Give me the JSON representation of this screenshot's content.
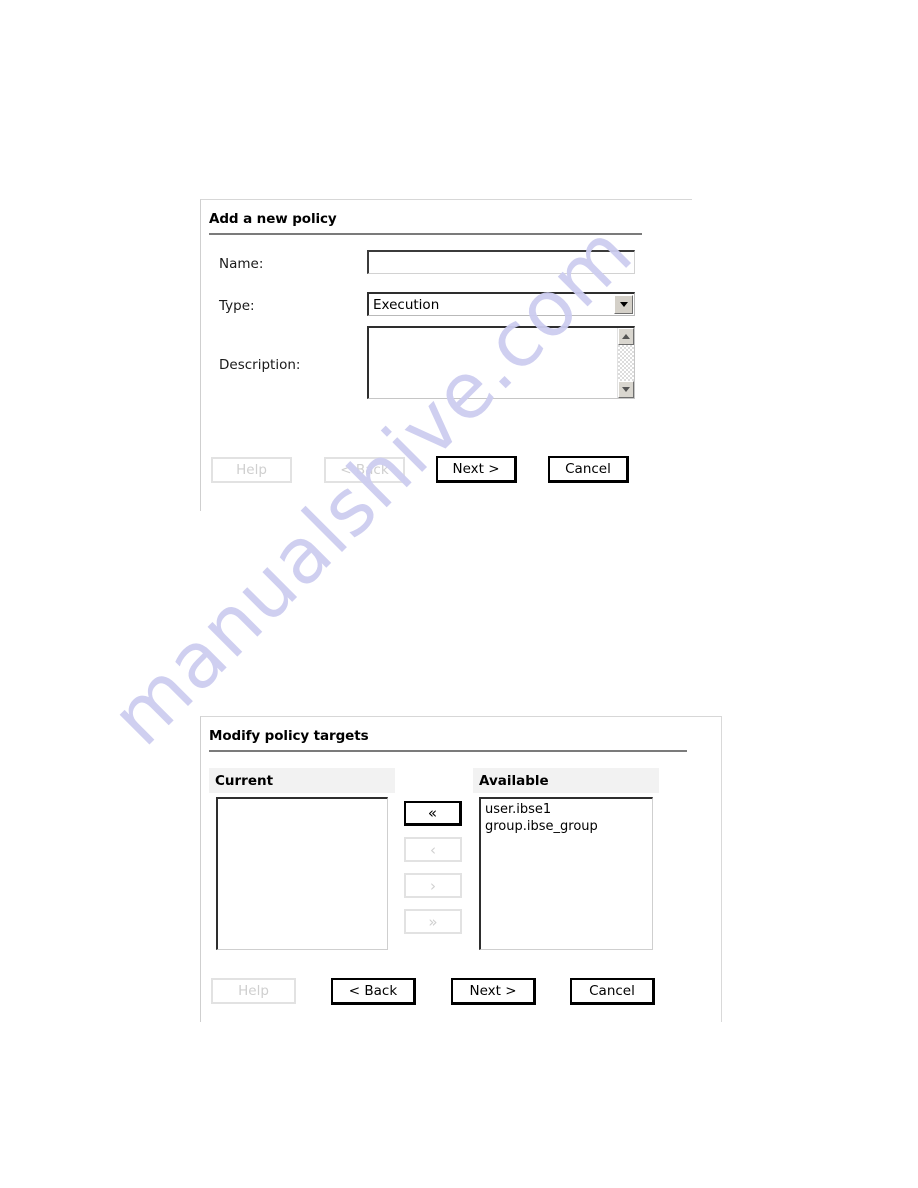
{
  "watermark": {
    "text": "manualshive.com"
  },
  "dialog_add_policy": {
    "title": "Add a new policy",
    "fields": {
      "name_label": "Name:",
      "name_value": "",
      "name_placeholder": "",
      "type_label": "Type:",
      "type_value": "Execution",
      "type_options": [
        "Execution"
      ],
      "description_label": "Description:",
      "description_value": "",
      "description_placeholder": ""
    },
    "buttons": {
      "help": "Help",
      "back": "< Back",
      "next": "Next >",
      "cancel": "Cancel"
    }
  },
  "dialog_modify_targets": {
    "title": "Modify policy targets",
    "current_header": "Current",
    "available_header": "Available",
    "current_items": [],
    "available_items": [
      "user.ibse1",
      "group.ibse_group"
    ],
    "transfer_buttons": {
      "add_all": "«",
      "add_one": "‹",
      "remove_one": "›",
      "remove_all": "»"
    },
    "buttons": {
      "help": "Help",
      "back": "< Back",
      "next": "Next >",
      "cancel": "Cancel"
    }
  }
}
